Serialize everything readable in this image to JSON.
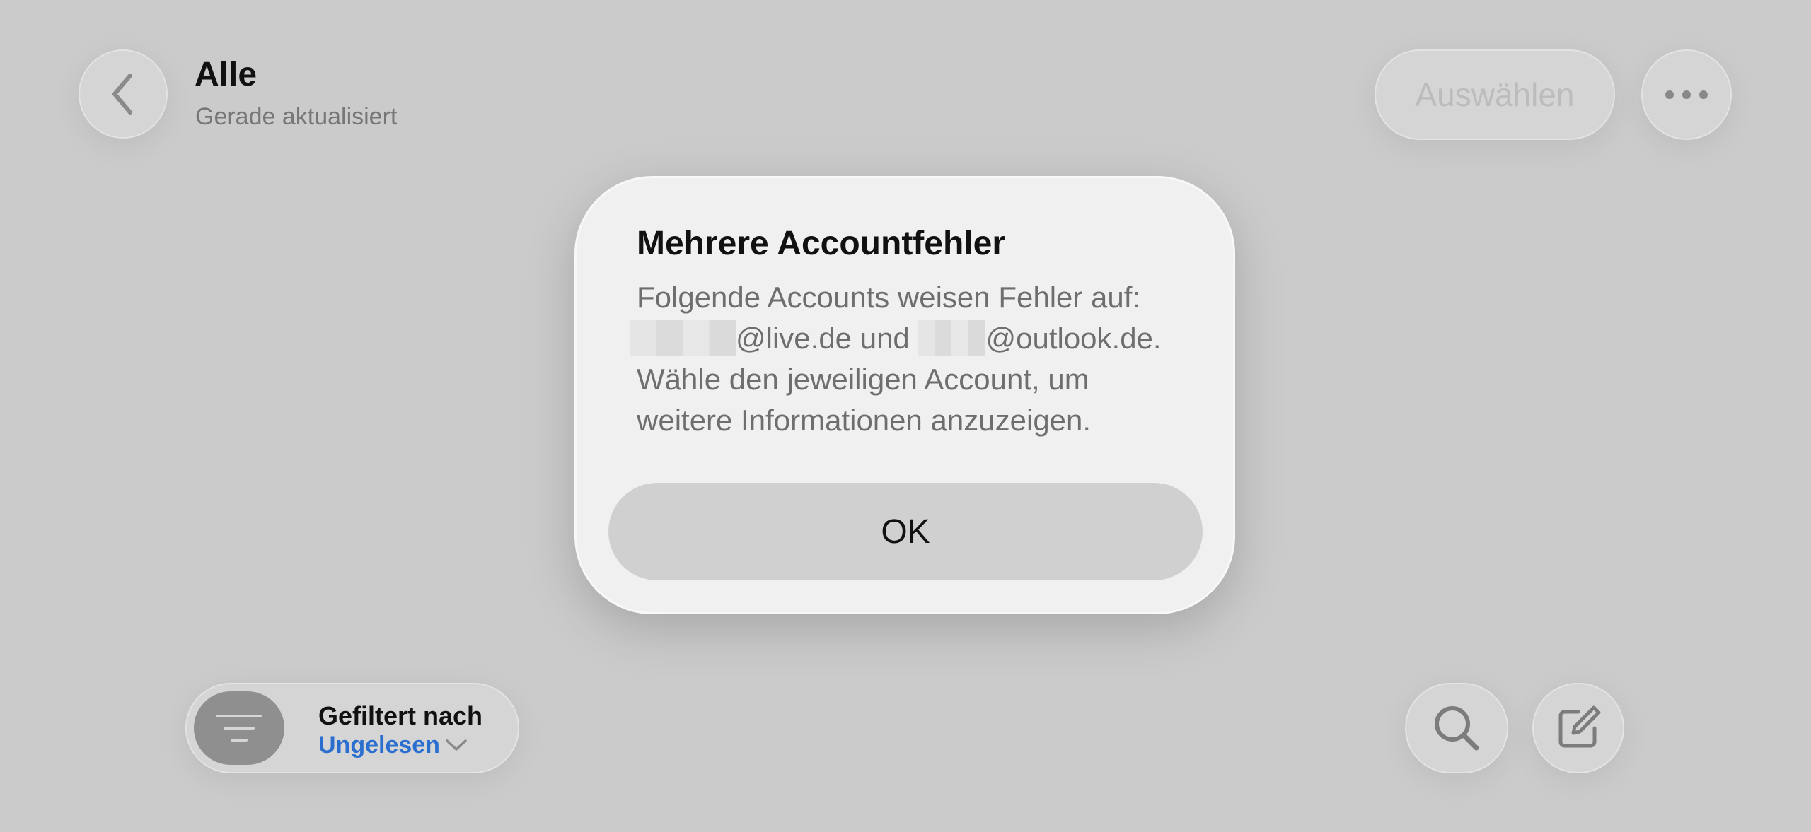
{
  "header": {
    "title": "Alle",
    "subtitle": "Gerade aktualisiert",
    "select_label": "Auswählen"
  },
  "icons": {
    "back": "chevron-left-icon",
    "more": "ellipsis-icon",
    "filter": "filter-lines-icon",
    "search": "search-icon",
    "compose": "compose-icon"
  },
  "filter": {
    "label": "Gefiltert nach",
    "value": "Ungelesen"
  },
  "dialog": {
    "title": "Mehrere Accountfehler",
    "line1": "Folgende Accounts weisen Fehler auf:",
    "account1_domain": "@live.de",
    "conjunction": " und ",
    "account2_domain": "@outlook.de.",
    "line3": "Wähle den jeweiligen Account, um",
    "line4": "weitere Informationen anzuzeigen.",
    "ok_label": "OK"
  },
  "colors": {
    "background": "#cbcbcb",
    "dialog": "#eff0ef",
    "accent": "#2a6fd0"
  }
}
